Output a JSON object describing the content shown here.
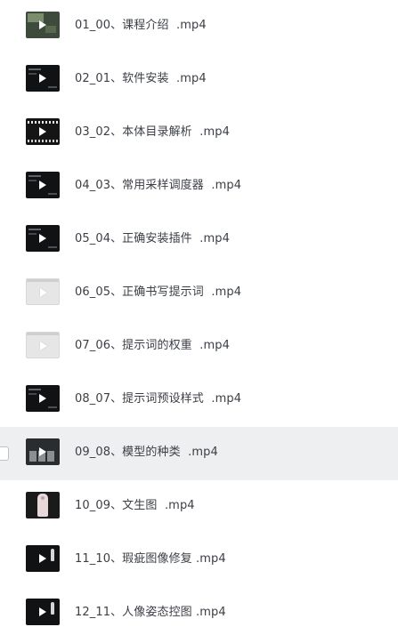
{
  "files": [
    {
      "name": "01_00、课程介绍  .mp4",
      "thumb": "photo",
      "thumb_icon": "video-play-icon",
      "selected": false
    },
    {
      "name": "02_01、软件安装  .mp4",
      "thumb": "dark",
      "thumb_icon": "video-play-icon",
      "selected": false
    },
    {
      "name": "03_02、本体目录解析  .mp4",
      "thumb": "grid",
      "thumb_icon": "video-play-icon",
      "selected": false
    },
    {
      "name": "04_03、常用采样调度器  .mp4",
      "thumb": "dark",
      "thumb_icon": "video-play-icon",
      "selected": false
    },
    {
      "name": "05_04、正确安装插件  .mp4",
      "thumb": "dark",
      "thumb_icon": "video-play-icon",
      "selected": false
    },
    {
      "name": "06_05、正确书写提示词  .mp4",
      "thumb": "light",
      "thumb_icon": "video-play-icon",
      "selected": false
    },
    {
      "name": "07_06、提示词的权重  .mp4",
      "thumb": "light",
      "thumb_icon": "video-play-icon",
      "selected": false
    },
    {
      "name": "08_07、提示词预设样式  .mp4",
      "thumb": "dark",
      "thumb_icon": "video-play-icon",
      "selected": false
    },
    {
      "name": "09_08、模型的种类  .mp4",
      "thumb": "multi",
      "thumb_icon": "video-play-icon",
      "selected": true
    },
    {
      "name": "10_09、文生图  .mp4",
      "thumb": "portrait",
      "thumb_icon": "video-play-icon",
      "selected": false
    },
    {
      "name": "11_10、瑕疵图像修复 .mp4",
      "thumb": "dark-figure",
      "thumb_icon": "video-play-icon",
      "selected": false
    },
    {
      "name": "12_11、人像姿态控图 .mp4",
      "thumb": "dark-figure",
      "thumb_icon": "video-play-icon",
      "selected": false
    }
  ],
  "colors": {
    "text": "#3b3f45",
    "selected_row_bg": "#eeeff1",
    "background": "#ffffff"
  }
}
